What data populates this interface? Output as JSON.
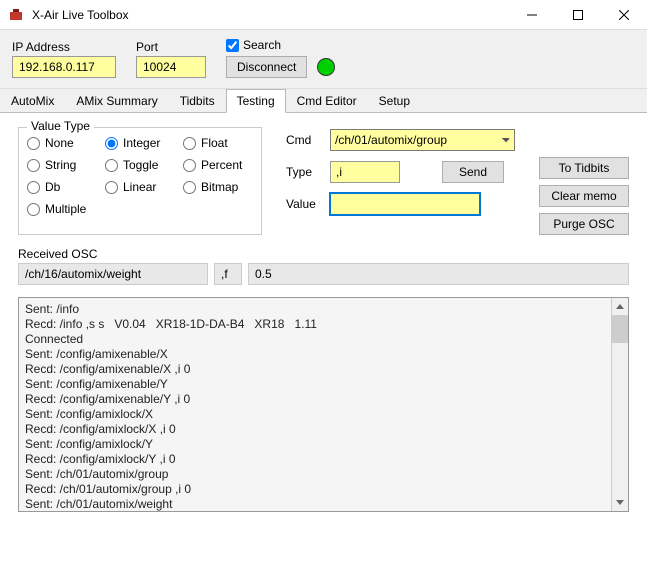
{
  "window": {
    "title": "X-Air Live Toolbox"
  },
  "conn": {
    "ip_label": "IP Address",
    "ip_value": "192.168.0.117",
    "port_label": "Port",
    "port_value": "10024",
    "search_label": "Search",
    "disconnect_label": "Disconnect"
  },
  "tabs": [
    "AutoMix",
    "AMix Summary",
    "Tidbits",
    "Testing",
    "Cmd Editor",
    "Setup"
  ],
  "active_tab": 3,
  "valtype": {
    "legend": "Value Type",
    "options": [
      "None",
      "Integer",
      "Float",
      "String",
      "Toggle",
      "Percent",
      "Db",
      "Linear",
      "Bitmap",
      "Multiple"
    ],
    "selected": "Integer"
  },
  "cmd": {
    "cmd_label": "Cmd",
    "cmd_value": "/ch/01/automix/group",
    "type_label": "Type",
    "type_value": ",i",
    "send_label": "Send",
    "value_label": "Value",
    "value_value": ""
  },
  "right_buttons": {
    "to_tidbits": "To Tidbits",
    "clear_memo": "Clear memo",
    "purge_osc": "Purge OSC"
  },
  "recv": {
    "label": "Received OSC",
    "path": "/ch/16/automix/weight",
    "type": ",f",
    "value": "0.5"
  },
  "memo_lines": [
    "Sent: /info",
    "Recd: /info ,s s   V0.04   XR18-1D-DA-B4   XR18   1.11",
    "Connected",
    "Sent: /config/amixenable/X",
    "Recd: /config/amixenable/X ,i 0",
    "Sent: /config/amixenable/Y",
    "Recd: /config/amixenable/Y ,i 0",
    "Sent: /config/amixlock/X",
    "Recd: /config/amixlock/X ,i 0",
    "Sent: /config/amixlock/Y",
    "Recd: /config/amixlock/Y ,i 0",
    "Sent: /ch/01/automix/group",
    "Recd: /ch/01/automix/group ,i 0",
    "Sent: /ch/01/automix/weight"
  ]
}
